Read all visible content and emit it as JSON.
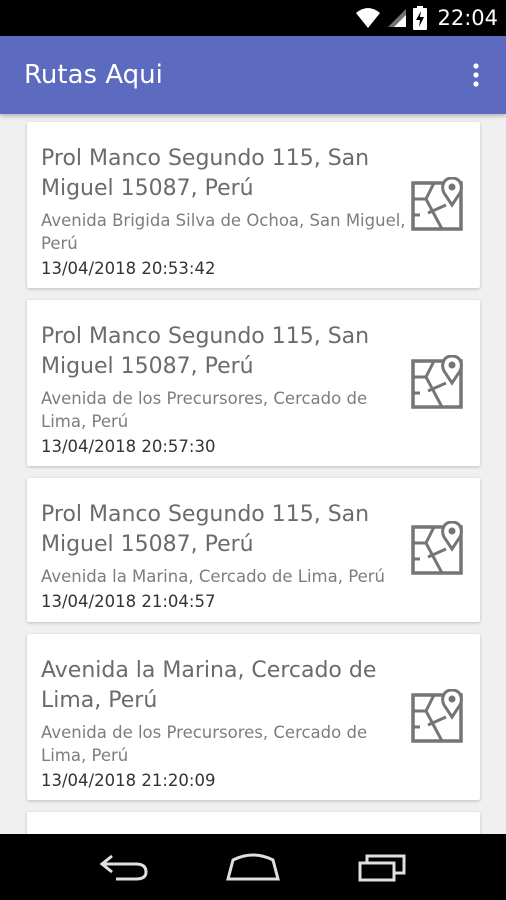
{
  "status_bar": {
    "time": "22:04",
    "icons": [
      "wifi-icon",
      "signal-icon",
      "battery-charging-icon"
    ]
  },
  "app_bar": {
    "title": "Rutas Aqui",
    "menu_icon": "overflow-menu-icon"
  },
  "routes": [
    {
      "origin": "Prol Manco Segundo 115, San Miguel 15087, Perú",
      "destination": "Avenida Brigida Silva de Ochoa, San Miguel, Perú",
      "datetime": "13/04/2018 20:53:42",
      "icon": "map-icon"
    },
    {
      "origin": "Prol Manco Segundo 115, San Miguel 15087, Perú",
      "destination": "Avenida de los Precursores, Cercado de Lima, Perú",
      "datetime": "13/04/2018 20:57:30",
      "icon": "map-icon"
    },
    {
      "origin": "Prol Manco Segundo 115, San Miguel 15087, Perú",
      "destination": "Avenida la Marina, Cercado de Lima, Perú",
      "datetime": "13/04/2018 21:04:57",
      "icon": "map-icon"
    },
    {
      "origin": "Avenida la Marina, Cercado de Lima, Perú",
      "destination": "Avenida de los Precursores, Cercado de Lima, Perú",
      "datetime": "13/04/2018 21:20:09",
      "icon": "map-icon"
    }
  ],
  "nav_bar": {
    "icons": [
      "back-icon",
      "home-icon",
      "recents-icon"
    ]
  },
  "colors": {
    "primary": "#5c6bc0",
    "background": "#f0f0f0",
    "card": "#ffffff"
  }
}
